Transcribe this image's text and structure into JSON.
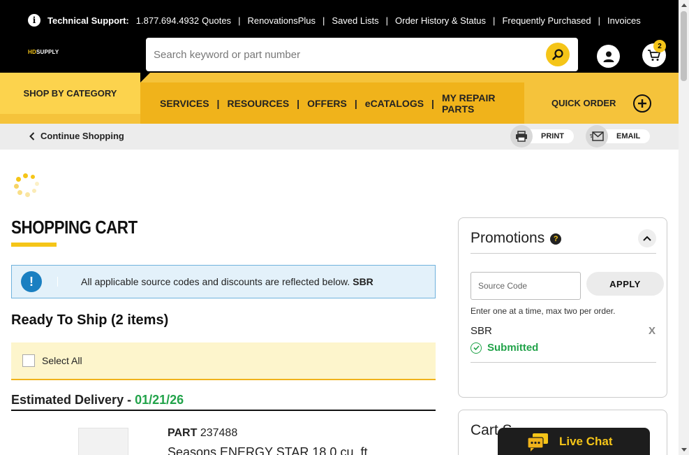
{
  "header": {
    "support_label": "Technical Support:",
    "phone": "1.877.694.4932",
    "links": [
      "Quotes",
      "RenovationsPlus",
      "Saved Lists",
      "Order History & Status",
      "Frequently Purchased",
      "Invoices"
    ],
    "separator": "|",
    "logo_prefix": "HD",
    "logo_suffix": "SUPPLY",
    "search_placeholder": "Search keyword or part number",
    "cart_count": "2"
  },
  "nav": {
    "shop_by_category": "SHOP BY CATEGORY",
    "items": [
      "SERVICES",
      "RESOURCES",
      "OFFERS",
      "eCATALOGS"
    ],
    "repair_line1": "MY REPAIR",
    "repair_line2": "PARTS",
    "quick_order": "QUICK ORDER"
  },
  "subbar": {
    "continue": "Continue Shopping",
    "print": "PRINT",
    "email": "EMAIL"
  },
  "cart": {
    "title": "SHOPPING CART",
    "notice_text": "All applicable source codes and discounts are reflected below.",
    "notice_code": "SBR",
    "ready_heading": "Ready To Ship (2 items)",
    "select_all": "Select All",
    "est_label": "Estimated Delivery - ",
    "est_date": "01/21/26",
    "part_label": "PART",
    "part_number": "237488",
    "product_name": "Seasons ENERGY STAR 18.0 cu. ft."
  },
  "promotions": {
    "title": "Promotions",
    "help_icon": "?",
    "source_placeholder": "Source Code",
    "apply": "APPLY",
    "hint": "Enter one at a time, max two per order.",
    "code": "SBR",
    "remove": "X",
    "status": "Submitted"
  },
  "summary": {
    "title": "Cart S"
  },
  "chat": {
    "label": "Live Chat"
  },
  "colors": {
    "brand_yellow": "#f5c518",
    "nav_yellow": "#f0b31b",
    "success_green": "#22a34a",
    "info_blue": "#1a7fc1"
  }
}
